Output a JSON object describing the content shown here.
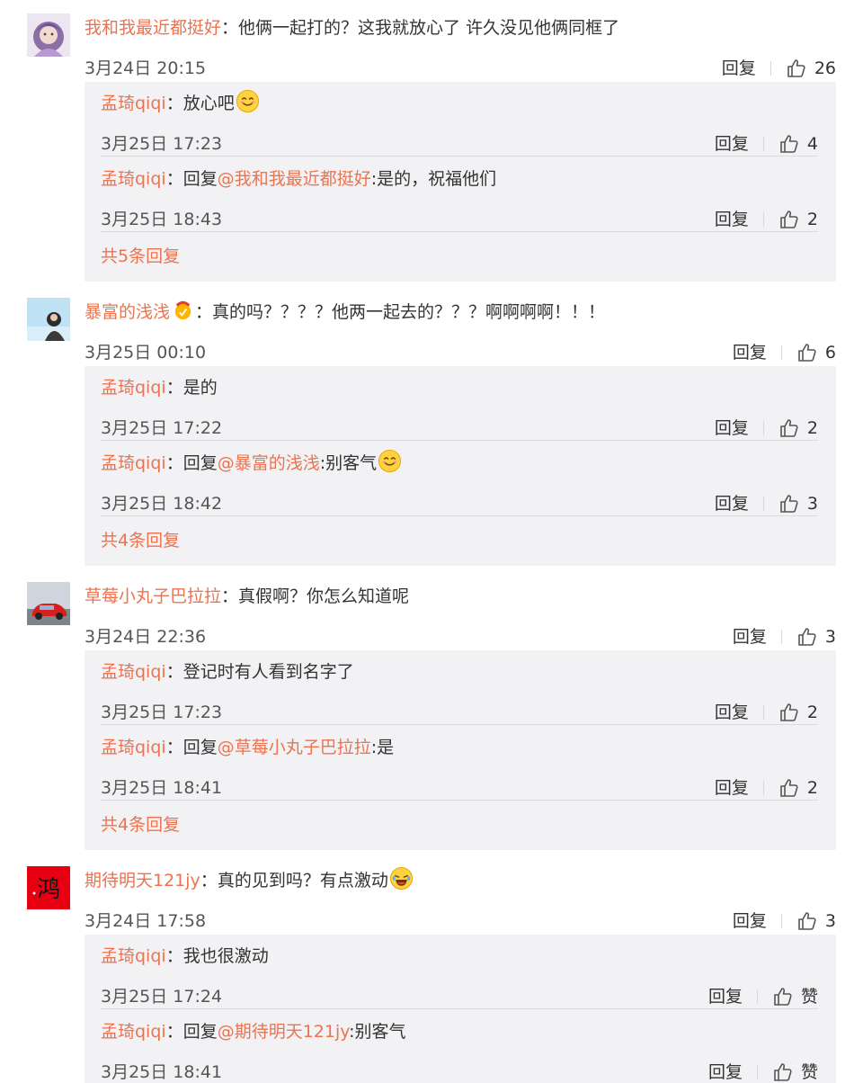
{
  "comments": [
    {
      "user": "我和我最近都挺好",
      "text": "他俩一起打的？这我就放心了 许久没见他俩同框了",
      "date": "3月24日 20:15",
      "reply_label": "回复",
      "likes": "26",
      "replies": [
        {
          "user": "孟琦qiqi",
          "text": "放心吧",
          "emoji": "smile-emoji",
          "date": "3月25日 17:23",
          "reply_label": "回复",
          "likes": "4"
        },
        {
          "user": "孟琦qiqi",
          "prefix": "回复",
          "mention": "@我和我最近都挺好",
          "text": ":是的，祝福他们",
          "date": "3月25日 18:43",
          "reply_label": "回复",
          "likes": "2"
        }
      ],
      "more": "共5条回复"
    },
    {
      "user": "暴富的浅浅",
      "user_badge": "fan-badge-icon",
      "text": "真的吗？？？？他两一起去的？？？啊啊啊啊！！！",
      "date": "3月25日 00:10",
      "reply_label": "回复",
      "likes": "6",
      "replies": [
        {
          "user": "孟琦qiqi",
          "text": "是的",
          "date": "3月25日 17:22",
          "reply_label": "回复",
          "likes": "2"
        },
        {
          "user": "孟琦qiqi",
          "prefix": "回复",
          "mention": "@暴富的浅浅",
          "text": ":别客气",
          "emoji": "smile-emoji",
          "date": "3月25日 18:42",
          "reply_label": "回复",
          "likes": "3"
        }
      ],
      "more": "共4条回复"
    },
    {
      "user": "草莓小丸子巴拉拉",
      "text": "真假啊？你怎么知道呢",
      "date": "3月24日 22:36",
      "reply_label": "回复",
      "likes": "3",
      "replies": [
        {
          "user": "孟琦qiqi",
          "text": "登记时有人看到名字了",
          "date": "3月25日 17:23",
          "reply_label": "回复",
          "likes": "2"
        },
        {
          "user": "孟琦qiqi",
          "prefix": "回复",
          "mention": "@草莓小丸子巴拉拉",
          "text": ":是",
          "date": "3月25日 18:41",
          "reply_label": "回复",
          "likes": "2"
        }
      ],
      "more": "共4条回复"
    },
    {
      "user": "期待明天121jy",
      "text": "真的见到吗？有点激动",
      "emoji": "laugh-emoji",
      "date": "3月24日 17:58",
      "reply_label": "回复",
      "likes": "3",
      "replies": [
        {
          "user": "孟琦qiqi",
          "text": "我也很激动",
          "date": "3月25日 17:24",
          "reply_label": "回复",
          "likes": "赞"
        },
        {
          "user": "孟琦qiqi",
          "prefix": "回复",
          "mention": "@期待明天121jy",
          "text": ":别客气",
          "date": "3月25日 18:41",
          "reply_label": "回复",
          "likes": "赞"
        }
      ]
    }
  ],
  "avatar_icons": [
    "avatar-girl-purple",
    "avatar-girl-sky",
    "avatar-red-car",
    "avatar-red-calligraphy"
  ],
  "avatar_calligraphy": "鸿",
  "colors": {
    "username": "#eb7350",
    "reply_box": "#f2f2f5",
    "text": "#333333",
    "meta": "#555555"
  }
}
